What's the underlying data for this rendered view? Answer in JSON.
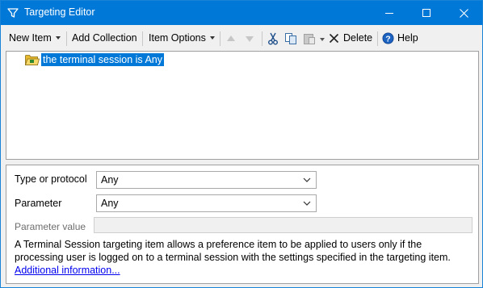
{
  "window": {
    "title": "Targeting Editor",
    "accent_color": "#0078d7",
    "app_icon": "funnel-icon",
    "controls": [
      "minimize-icon",
      "maximize-icon",
      "close-icon"
    ]
  },
  "toolbar": {
    "new_item_label": "New Item",
    "add_collection_label": "Add Collection",
    "item_options_label": "Item Options",
    "delete_label": "Delete",
    "help_label": "Help",
    "icons": [
      "move-up-icon",
      "move-down-icon",
      "cut-icon",
      "copy-icon",
      "paste-icon",
      "delete-x-icon",
      "help-icon"
    ]
  },
  "tree": {
    "items": [
      {
        "label": "the terminal session is Any",
        "icon": "folder-icon",
        "selected": true
      }
    ]
  },
  "form": {
    "type_label": "Type or protocol",
    "type_value": "Any",
    "parameter_label": "Parameter",
    "parameter_value": "Any",
    "parameter_value_label": "Parameter value",
    "parameter_value_text": ""
  },
  "description": {
    "text": "A Terminal Session targeting item allows a preference item to be applied to users only if the processing user is logged on to a terminal session with the settings specified in the targeting item.",
    "link_text": "Additional information..."
  }
}
